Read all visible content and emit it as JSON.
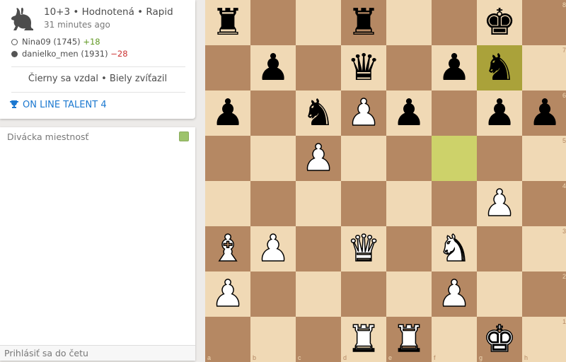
{
  "game": {
    "title": "10+3 • Hodnotená • Rapid",
    "time_ago": "31 minutes ago",
    "icon": "rabbit-icon",
    "players": [
      {
        "name": "Nina09 (1745)",
        "diff": "+18",
        "color": "white"
      },
      {
        "name": "danielko_men (1931)",
        "diff": "−28",
        "color": "black"
      }
    ],
    "result": "Čierny sa vzdal • Biely zvíťazil",
    "tournament": "ON LINE TALENT 4"
  },
  "chat": {
    "title": "Divácka miestnosť",
    "placeholder": "Prihlásiť sa do četu"
  },
  "board": {
    "files": [
      "a",
      "b",
      "c",
      "d",
      "e",
      "f",
      "g",
      "h"
    ],
    "ranks": [
      "8",
      "7",
      "6",
      "5",
      "4",
      "3",
      "2",
      "1"
    ],
    "rows": [
      [
        "r",
        "",
        "",
        "r",
        "",
        "",
        "k",
        ""
      ],
      [
        "",
        "p",
        "",
        "q",
        "",
        "p",
        "n",
        ""
      ],
      [
        "p",
        "",
        "n",
        "P",
        "p",
        "",
        "p",
        "p"
      ],
      [
        "",
        "",
        "P",
        "",
        "",
        "",
        "",
        ""
      ],
      [
        "",
        "",
        "",
        "",
        "",
        "",
        "P",
        ""
      ],
      [
        "B",
        "P",
        "",
        "Q",
        "",
        "N",
        "",
        ""
      ],
      [
        "P",
        "",
        "",
        "",
        "",
        "P",
        "",
        ""
      ],
      [
        "",
        "",
        "",
        "R",
        "R",
        "",
        "K",
        ""
      ]
    ],
    "highlights": [
      "g7",
      "f5"
    ],
    "colors": {
      "light": "#f0d9b5",
      "dark": "#b58863",
      "highlight_light": "#cdd26a",
      "highlight_dark": "#aaa23a"
    }
  }
}
